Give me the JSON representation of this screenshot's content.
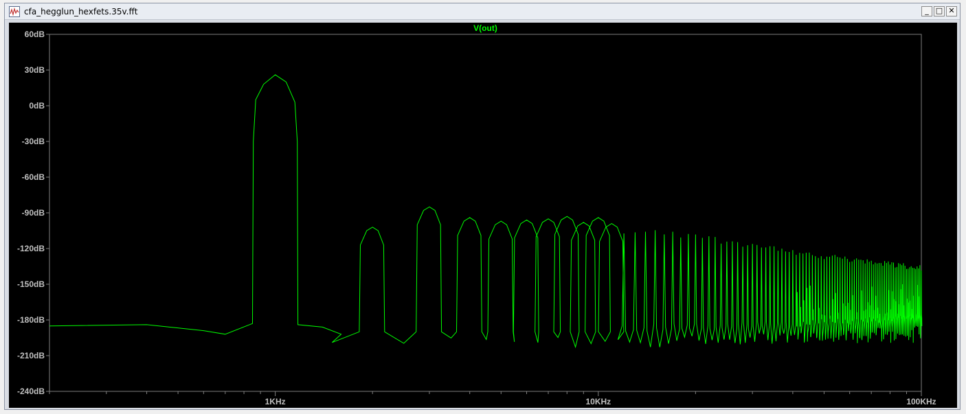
{
  "window": {
    "title": "cfa_hegglun_hexfets.35v.fft",
    "minimize_label": "_",
    "maximize_label": "□",
    "close_label": "✕"
  },
  "colors": {
    "trace": "#00ff00",
    "background": "#000000",
    "axis_text": "#c0c0c0",
    "frame": "#808080"
  },
  "chart_data": {
    "type": "line",
    "title": "V(out)",
    "x_scale": "log",
    "xlim": [
      200,
      100000
    ],
    "ylim": [
      -240,
      60
    ],
    "y_ticks": [
      "60dB",
      "30dB",
      "0dB",
      "-30dB",
      "-60dB",
      "-90dB",
      "-120dB",
      "-150dB",
      "-180dB",
      "-210dB",
      "-240dB"
    ],
    "x_ticks": [
      {
        "value": 1000,
        "label": "1KHz"
      },
      {
        "value": 10000,
        "label": "10KHz"
      },
      {
        "value": 100000,
        "label": "100KHz"
      }
    ],
    "grid": false,
    "series": [
      {
        "name": "V(out)",
        "fundamental": {
          "freq": 1000,
          "peak_db": 26
        },
        "harmonics": [
          {
            "n": 2,
            "peak_db": -102
          },
          {
            "n": 3,
            "peak_db": -85
          },
          {
            "n": 4,
            "peak_db": -94
          },
          {
            "n": 5,
            "peak_db": -97
          },
          {
            "n": 6,
            "peak_db": -96
          },
          {
            "n": 7,
            "peak_db": -95
          },
          {
            "n": 8,
            "peak_db": -93
          },
          {
            "n": 9,
            "peak_db": -98
          },
          {
            "n": 10,
            "peak_db": -94
          },
          {
            "n": 11,
            "peak_db": -99
          },
          {
            "n": 12,
            "peak_db": -104
          },
          {
            "n": 13,
            "peak_db": -103
          },
          {
            "n": 14,
            "peak_db": -105
          },
          {
            "n": 15,
            "peak_db": -104
          },
          {
            "n": 16,
            "peak_db": -106
          },
          {
            "n": 17,
            "peak_db": -105
          },
          {
            "n": 18,
            "peak_db": -108
          },
          {
            "n": 19,
            "peak_db": -106
          },
          {
            "n": 20,
            "peak_db": -107
          },
          {
            "n": 25,
            "peak_db": -112
          },
          {
            "n": 30,
            "peak_db": -115
          },
          {
            "n": 40,
            "peak_db": -121
          },
          {
            "n": 50,
            "peak_db": -124
          },
          {
            "n": 60,
            "peak_db": -127
          },
          {
            "n": 80,
            "peak_db": -131
          },
          {
            "n": 100,
            "peak_db": -134
          }
        ],
        "noise_floor_points": [
          [
            200,
            -185
          ],
          [
            400,
            -184
          ],
          [
            600,
            -189
          ],
          [
            700,
            -192
          ],
          [
            850,
            -183
          ],
          [
            1400,
            -186
          ],
          [
            1600,
            -192
          ],
          [
            1900,
            -190
          ],
          [
            2400,
            -192
          ],
          [
            2700,
            -190
          ],
          [
            3500,
            -203
          ]
        ]
      }
    ]
  }
}
